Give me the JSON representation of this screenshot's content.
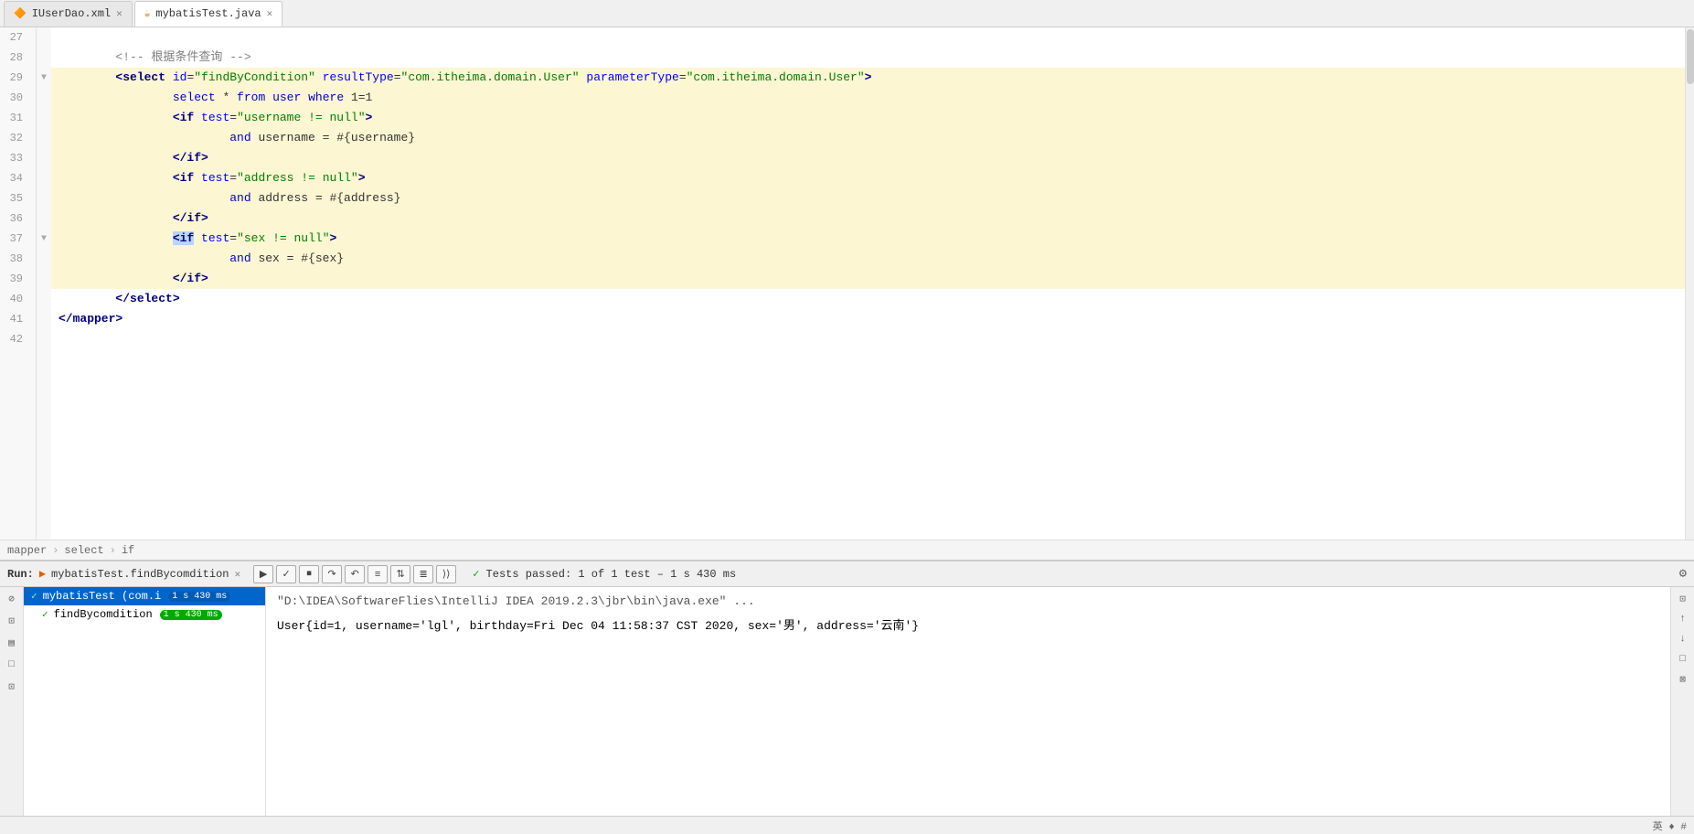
{
  "tabs": [
    {
      "id": "iuserdao",
      "label": "IUserDao.xml",
      "icon": "xml",
      "active": false
    },
    {
      "id": "mybatistest",
      "label": "mybatisTest.java",
      "icon": "java",
      "active": true
    }
  ],
  "editor": {
    "lines": [
      {
        "num": 27,
        "indent": 0,
        "content": "",
        "highlighted": false,
        "gutter": ""
      },
      {
        "num": 28,
        "indent": 2,
        "content": "<!-- 根据条件查询 -->",
        "highlighted": false,
        "gutter": ""
      },
      {
        "num": 29,
        "indent": 2,
        "content": "<select id=\"findByCondition\" resultType=\"com.itheima.domain.User\" parameterType=\"com.itheima.domain.User\">",
        "highlighted": true,
        "gutter": "▼"
      },
      {
        "num": 30,
        "indent": 4,
        "content": "select * from user where 1=1",
        "highlighted": true,
        "gutter": ""
      },
      {
        "num": 31,
        "indent": 4,
        "content": "<if test=\"username != null\">",
        "highlighted": true,
        "gutter": ""
      },
      {
        "num": 32,
        "indent": 6,
        "content": "and username = #{username}",
        "highlighted": true,
        "gutter": ""
      },
      {
        "num": 33,
        "indent": 4,
        "content": "</if>",
        "highlighted": true,
        "gutter": ""
      },
      {
        "num": 34,
        "indent": 4,
        "content": "<if test=\"address != null\">",
        "highlighted": true,
        "gutter": ""
      },
      {
        "num": 35,
        "indent": 6,
        "content": "and address = #{address}",
        "highlighted": true,
        "gutter": ""
      },
      {
        "num": 36,
        "indent": 4,
        "content": "</if>",
        "highlighted": true,
        "gutter": ""
      },
      {
        "num": 37,
        "indent": 4,
        "content": "<if test=\"sex != null\">",
        "highlighted": true,
        "gutter": "▼"
      },
      {
        "num": 38,
        "indent": 6,
        "content": "and sex = #{sex}",
        "highlighted": true,
        "gutter": ""
      },
      {
        "num": 39,
        "indent": 4,
        "content": "</if>",
        "highlighted": true,
        "gutter": ""
      },
      {
        "num": 40,
        "indent": 2,
        "content": "</select>",
        "highlighted": false,
        "gutter": ""
      },
      {
        "num": 41,
        "indent": 0,
        "content": "</mapper>",
        "highlighted": false,
        "gutter": ""
      },
      {
        "num": 42,
        "indent": 0,
        "content": "",
        "highlighted": false,
        "gutter": ""
      }
    ],
    "breadcrumb": [
      "mapper",
      "select",
      "if"
    ]
  },
  "run_panel": {
    "title": "Run:",
    "tab_name": "mybatisTest.findBycomdition",
    "tests_passed": "Tests passed: 1 of 1 test – 1 s 430 ms",
    "sidebar_items": [
      {
        "label": "mybatisTest (com.i",
        "badge": "1 s 430 ms",
        "selected": true
      },
      {
        "label": "findBycomdition",
        "badge": "1 s 430 ms",
        "selected": false,
        "sub": true
      }
    ],
    "output_line1": "\"D:\\IDEA\\SoftwareFlies\\IntelliJ IDEA 2019.2.3\\jbr\\bin\\java.exe\" ...",
    "output_line2": "User{id=1, username='lgl', birthday=Fri Dec 04 11:58:37 CST 2020, sex='男', address='云南'}"
  },
  "status_bar": {
    "text": "英 ♦ #"
  }
}
